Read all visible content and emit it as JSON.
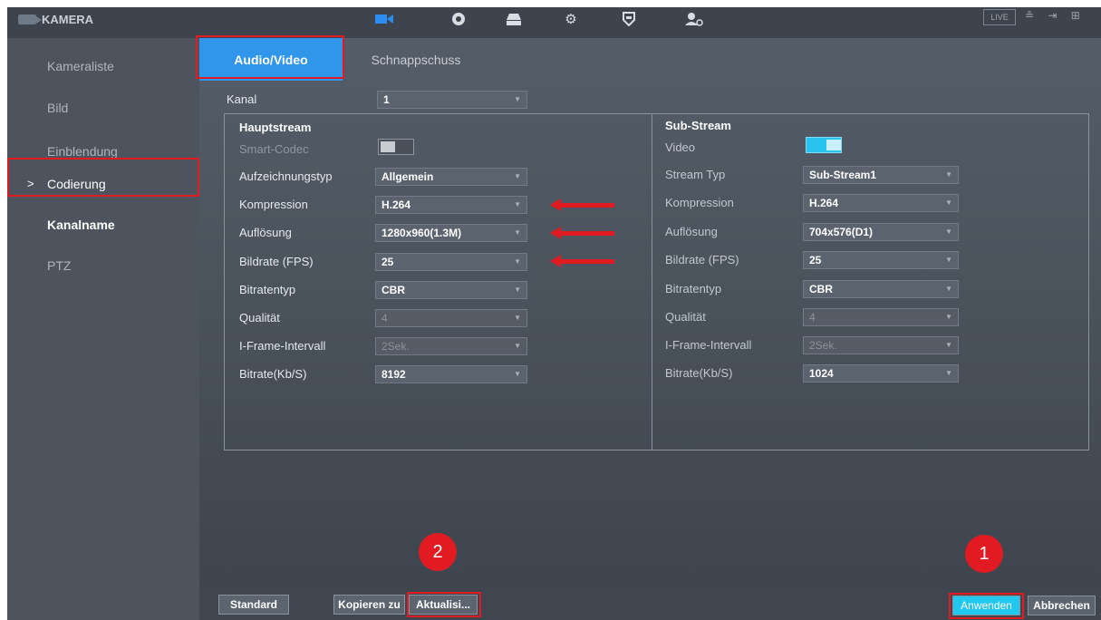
{
  "app": {
    "title": "KAMERA"
  },
  "topbar": {
    "icons": [
      "camera-icon",
      "network-icon",
      "storage-icon",
      "system-icon",
      "security-icon",
      "account-icon"
    ],
    "live_label": "LIVE",
    "status_icons": "≗ ⇥ ⊞"
  },
  "sidebar": {
    "items": [
      {
        "label": "Kameraliste"
      },
      {
        "label": "Bild"
      },
      {
        "label": "Einblendung"
      },
      {
        "label": "Codierung"
      },
      {
        "label": "Kanalname"
      },
      {
        "label": "PTZ"
      }
    ],
    "current_marker": ">"
  },
  "tabs": [
    {
      "label": "Audio/Video"
    },
    {
      "label": "Schnappschuss"
    }
  ],
  "channel": {
    "label": "Kanal",
    "value": "1"
  },
  "main_stream": {
    "title": "Hauptstream",
    "smart_codec_label": "Smart-Codec",
    "smart_codec_on": false,
    "fields": [
      {
        "label": "Aufzeichnungstyp",
        "value": "Allgemein",
        "disabled": false
      },
      {
        "label": "Kompression",
        "value": "H.264",
        "disabled": false
      },
      {
        "label": "Auflösung",
        "value": "1280x960(1.3M)",
        "disabled": false
      },
      {
        "label": "Bildrate (FPS)",
        "value": "25",
        "disabled": false
      },
      {
        "label": "Bitratentyp",
        "value": "CBR",
        "disabled": false
      },
      {
        "label": "Qualität",
        "value": "4",
        "disabled": true
      },
      {
        "label": "I-Frame-Intervall",
        "value": "2Sek.",
        "disabled": true
      },
      {
        "label": "Bitrate(Kb/S)",
        "value": "8192",
        "disabled": false
      }
    ]
  },
  "sub_stream": {
    "title": "Sub-Stream",
    "video_label": "Video",
    "video_on": true,
    "fields": [
      {
        "label": "Stream Typ",
        "value": "Sub-Stream1",
        "disabled": false
      },
      {
        "label": "Kompression",
        "value": "H.264",
        "disabled": false
      },
      {
        "label": "Auflösung",
        "value": "704x576(D1)",
        "disabled": false
      },
      {
        "label": "Bildrate (FPS)",
        "value": "25",
        "disabled": false
      },
      {
        "label": "Bitratentyp",
        "value": "CBR",
        "disabled": false
      },
      {
        "label": "Qualität",
        "value": "4",
        "disabled": true
      },
      {
        "label": "I-Frame-Intervall",
        "value": "2Sek.",
        "disabled": true
      },
      {
        "label": "Bitrate(Kb/S)",
        "value": "1024",
        "disabled": false
      }
    ]
  },
  "annotations": {
    "badge_1": "1",
    "badge_2": "2",
    "highlight_color": "#e21b22"
  },
  "footer": {
    "standard": "Standard",
    "copy_to": "Kopieren zu",
    "refresh": "Aktualisi...",
    "apply": "Anwenden",
    "cancel": "Abbrechen"
  },
  "colors": {
    "accent": "#2f96ea",
    "apply": "#22c7ee",
    "toggle_on": "#28c3ee"
  }
}
